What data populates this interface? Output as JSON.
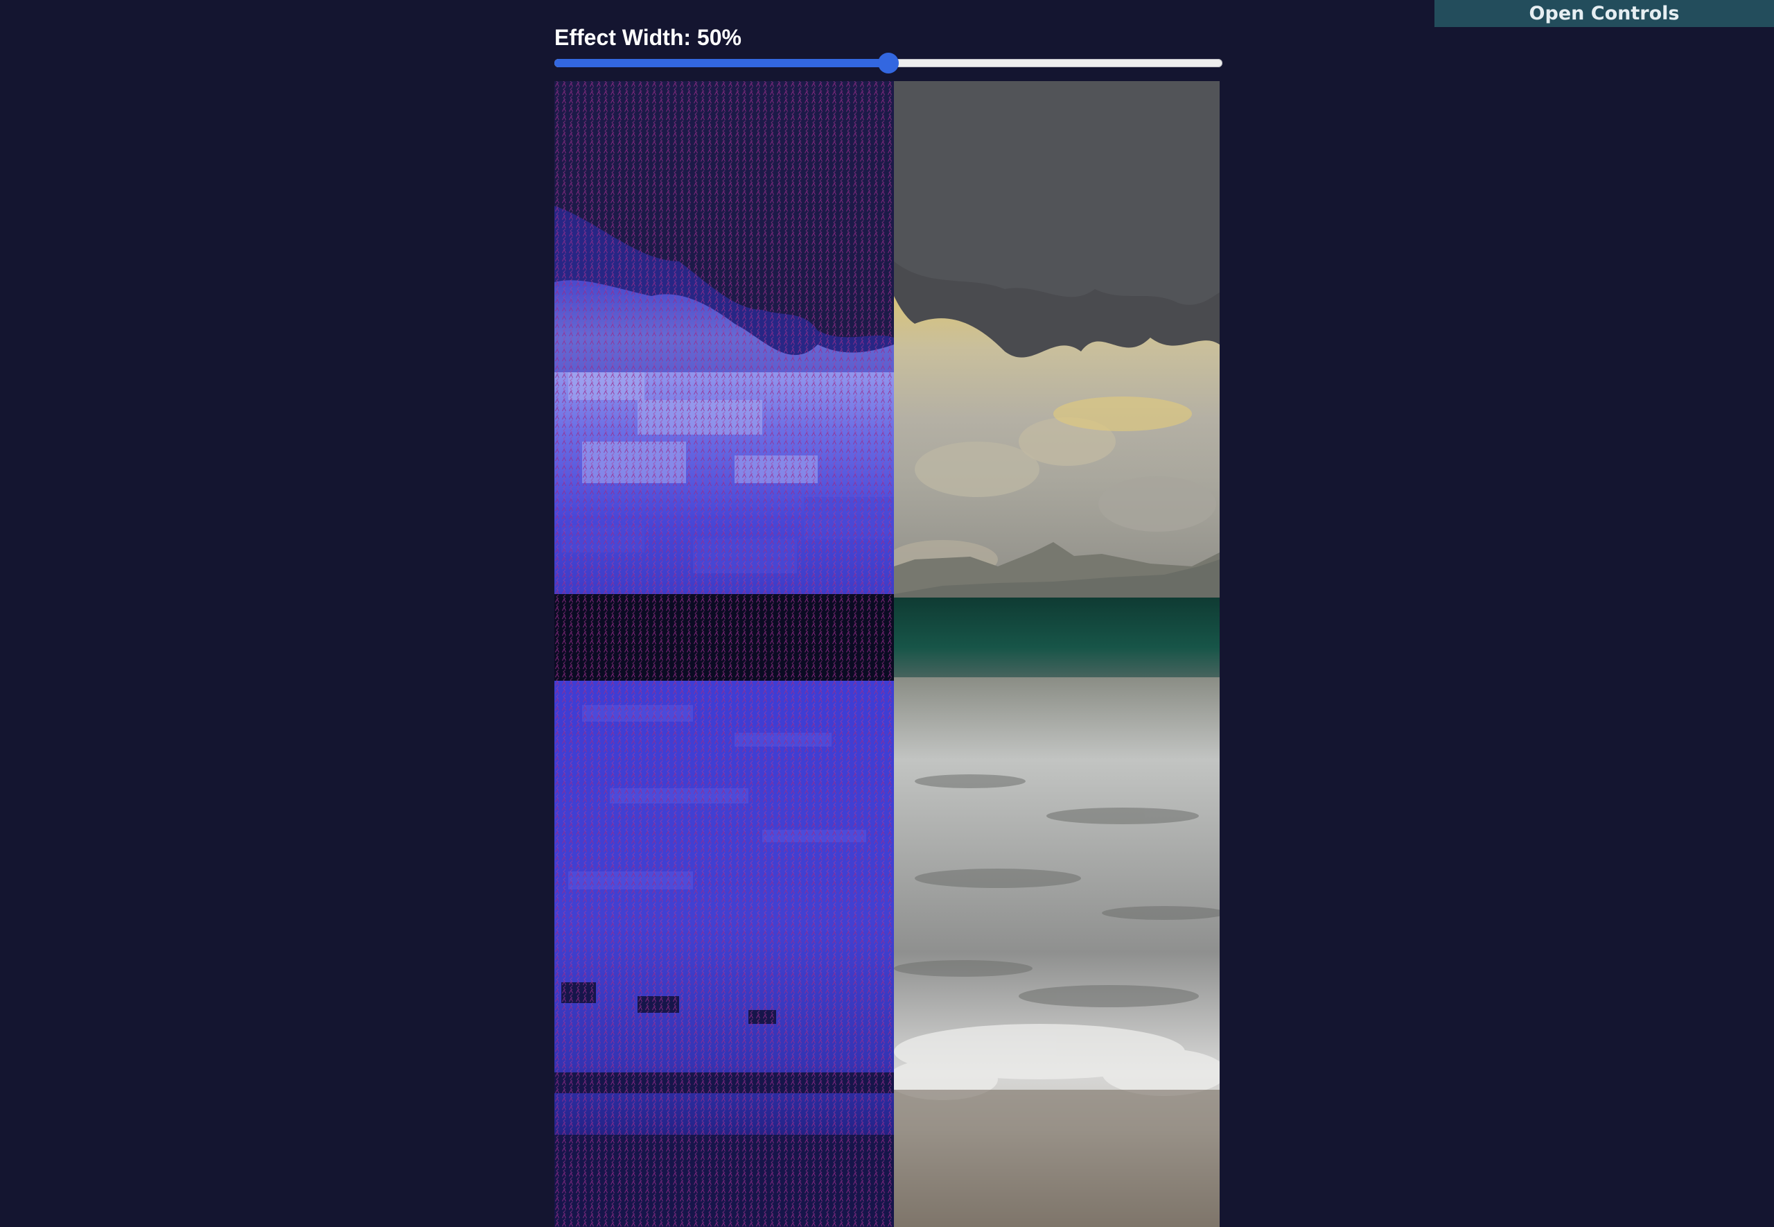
{
  "controls": {
    "toggle_label": "Open Controls"
  },
  "effect": {
    "label": "Effect Width: 50%",
    "width_percent": 50
  },
  "colors": {
    "background": "#141530",
    "accent": "#3367e0",
    "controls_button_bg": "#234d5c",
    "effect_tint": "#4a4ae6"
  },
  "scene": {
    "left_half": "ascii-effect",
    "right_half": "original-video"
  }
}
